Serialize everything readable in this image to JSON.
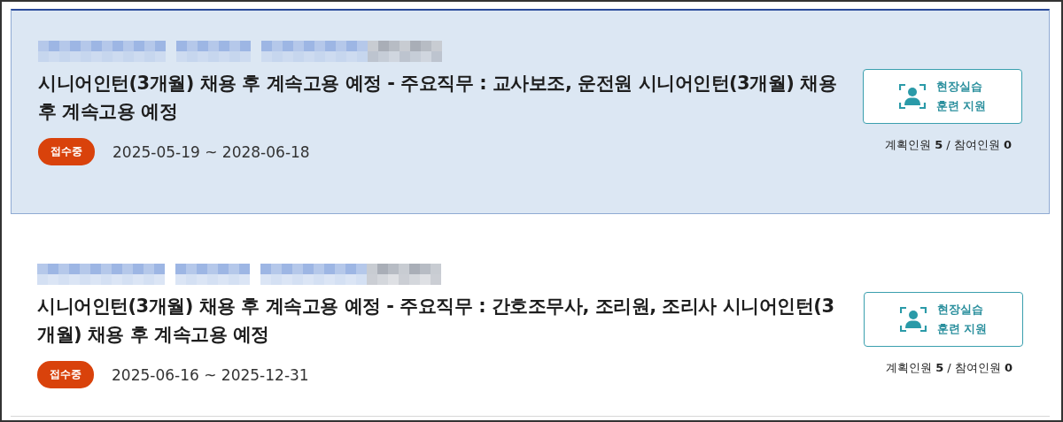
{
  "cards": [
    {
      "selected": true,
      "title": "시니어인턴(3개월) 채용 후 계속고용 예정 - 주요직무 : 교사보조, 운전원 시니어인턴(3개월) 채용 후 계속고용 예정",
      "status": "접수중",
      "period": "2025-05-19 ~ 2028-06-18",
      "action": {
        "lines": [
          "현장실습",
          "훈련 지원"
        ]
      },
      "counts": "계획인원 **5** / 참여인원 **0**"
    },
    {
      "selected": false,
      "title": "시니어인턴(3개월) 채용 후 계속고용 예정 - 주요직무 : 간호조무사, 조리원, 조리사 시니어인턴(3개월) 채용 후 계속고용 예정",
      "status": "접수중",
      "period": "2025-06-16 ~ 2025-12-31",
      "action": {
        "lines": [
          "현장실습",
          "훈련 지원"
        ]
      },
      "counts": "계획인원 **5** / 참여인원 **0**"
    }
  ]
}
